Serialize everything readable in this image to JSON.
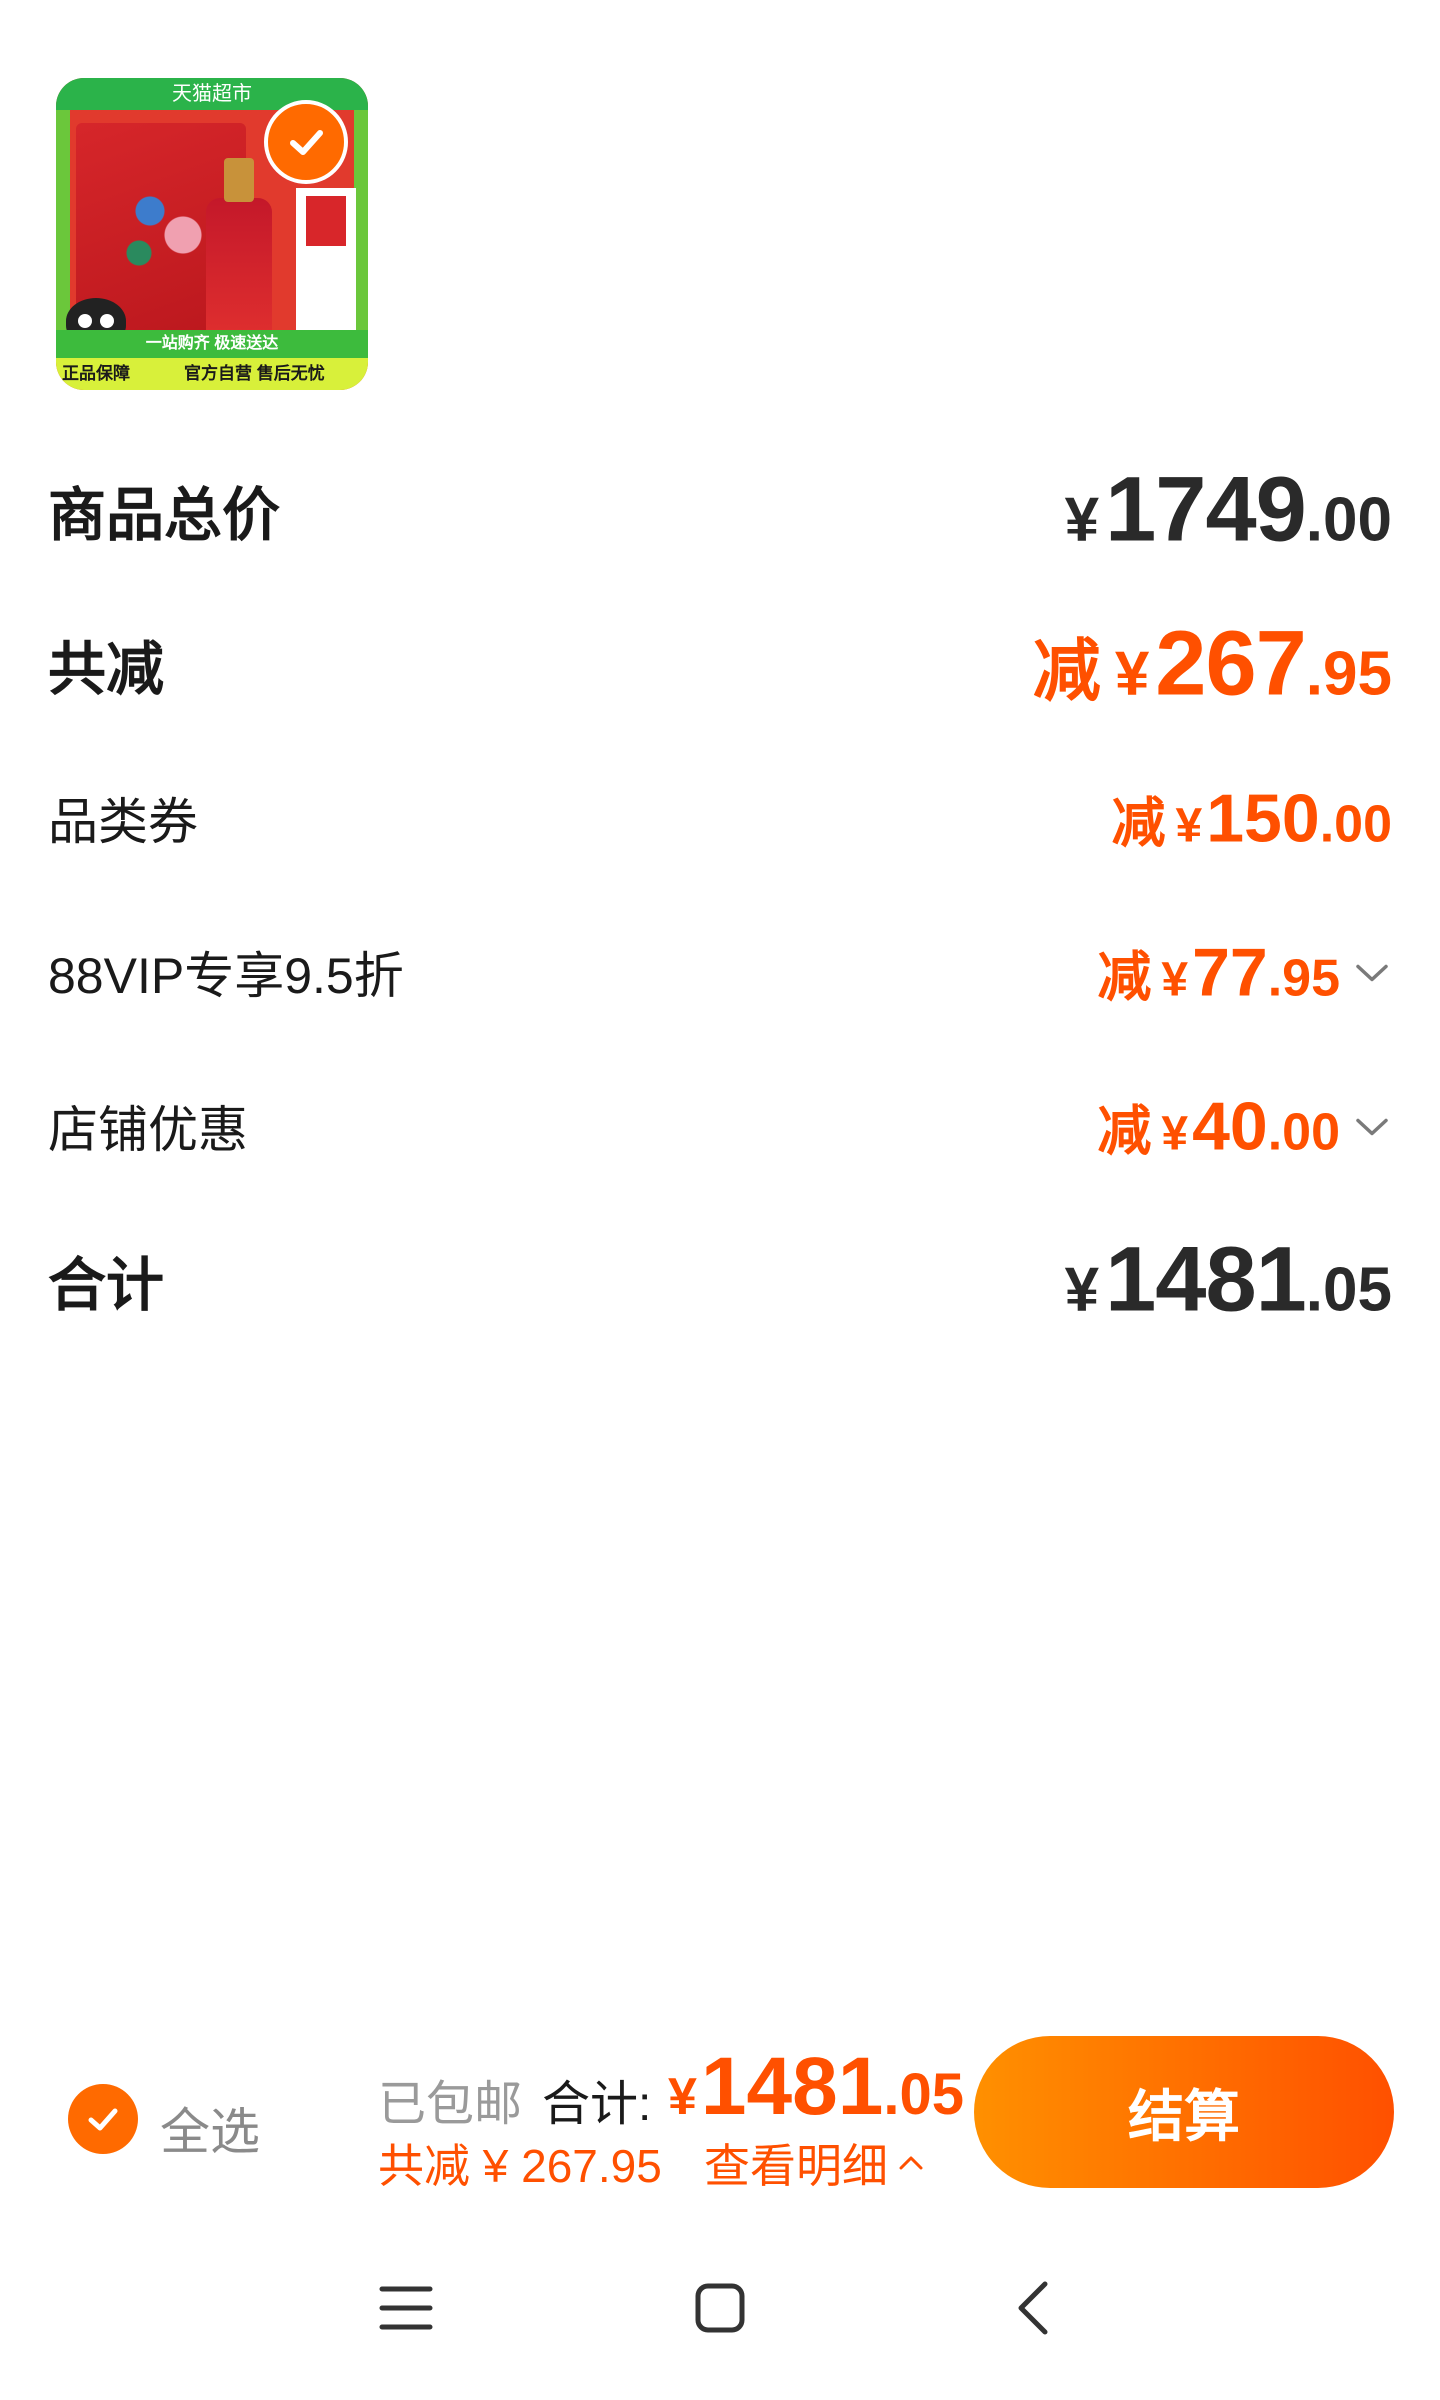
{
  "product": {
    "thumb_badge": "天猫超市",
    "thumb_strip": "一站购齐 极速送达",
    "thumb_tag_left": "正品保障",
    "thumb_tag_right": "官方自营 售后无忧",
    "selected": true
  },
  "rows": [
    {
      "label": "商品总价",
      "prefix": "",
      "yen": "¥",
      "int": "1749",
      "dec": ".00",
      "style": "dark",
      "expandable": false
    },
    {
      "label": "共减",
      "prefix": "减",
      "yen": "¥",
      "int": "267",
      "dec": ".95",
      "style": "orange",
      "expandable": false
    },
    {
      "label": "品类券",
      "prefix": "减",
      "yen": "¥",
      "int": "150",
      "dec": ".00",
      "style": "orange",
      "expandable": false
    },
    {
      "label": "88VIP专享9.5折",
      "prefix": "减",
      "yen": "¥",
      "int": "77",
      "dec": ".95",
      "style": "orange",
      "expandable": true
    },
    {
      "label": "店铺优惠",
      "prefix": "减",
      "yen": "¥",
      "int": "40",
      "dec": ".00",
      "style": "orange",
      "expandable": true
    },
    {
      "label": "合计",
      "prefix": "",
      "yen": "¥",
      "int": "1481",
      "dec": ".05",
      "style": "dark",
      "expandable": false
    }
  ],
  "bottom_bar": {
    "select_all": "全选",
    "shipping": "已包邮",
    "total_label": "合计:",
    "total_yen": "¥",
    "total_int": "1481",
    "total_dec": ".05",
    "discount": "共减 ¥ 267.95",
    "detail_link": "查看明细",
    "checkout": "结算"
  },
  "colors": {
    "accent": "#ff5000",
    "accent_light": "#ff9000",
    "text": "#1a1a1a",
    "muted": "#9a9a9a"
  },
  "nav": [
    "menu-icon",
    "home-icon",
    "back-icon"
  ]
}
